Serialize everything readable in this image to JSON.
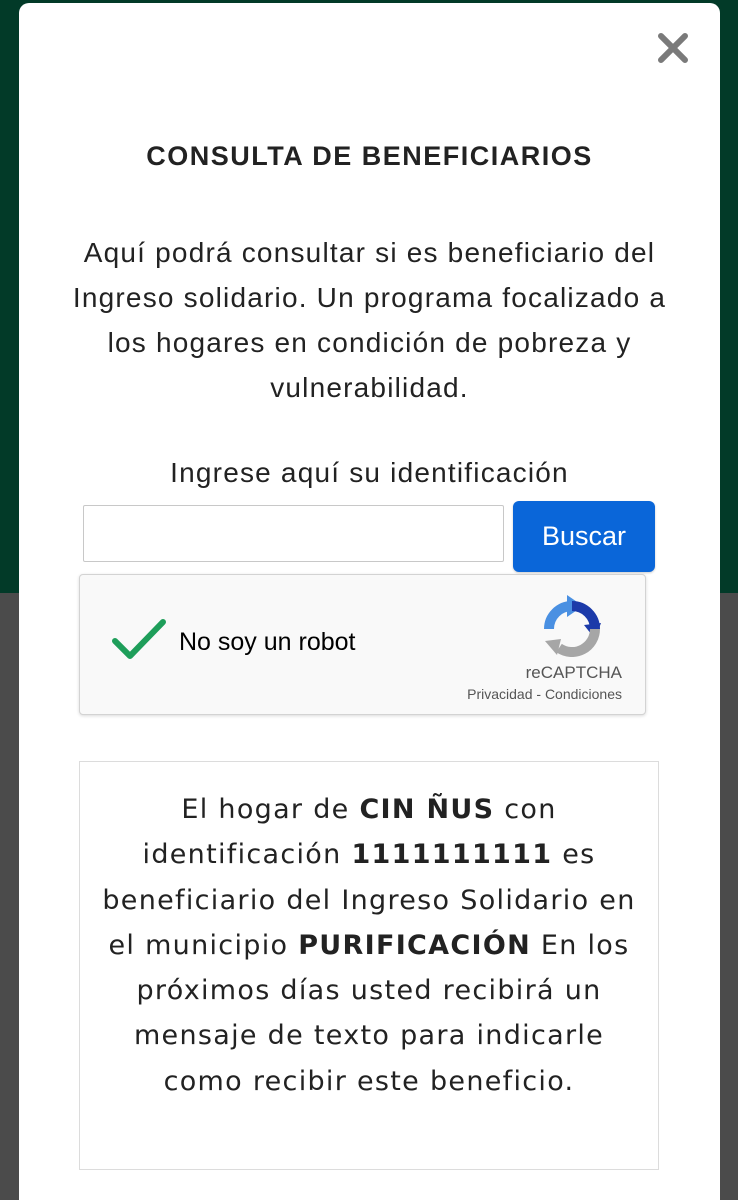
{
  "modal": {
    "title": "CONSULTA DE BENEFICIARIOS",
    "intro": "Aquí podrá consultar si es beneficiario del Ingreso solidario. Un programa focalizado a los hogares en condición de pobreza y vulnerabilidad.",
    "id_label": "Ingrese aquí su identificación",
    "id_input_value": "",
    "search_button": "Buscar",
    "close_icon": "close-icon"
  },
  "captcha": {
    "label": "No soy un robot",
    "brand": "reCAPTCHA",
    "privacy": "Privacidad",
    "separator": " - ",
    "terms": "Condiciones",
    "checked": true,
    "check_color": "#1e9e5a"
  },
  "result": {
    "part1": "El hogar de ",
    "name": "CIN ÑUS",
    "part2": " con identificación ",
    "id_number": "1111111111",
    "part3": " es beneficiario del Ingreso Solidario en el municipio ",
    "municipality": "PURIFICACIÓN",
    "part4": " En los próximos días usted recibirá un mensaje de texto para indicarle como recibir este beneficio."
  },
  "colors": {
    "header_bg": "#023a28",
    "overlay_bg": "#4b4b4b",
    "button_bg": "#0a66d9"
  }
}
